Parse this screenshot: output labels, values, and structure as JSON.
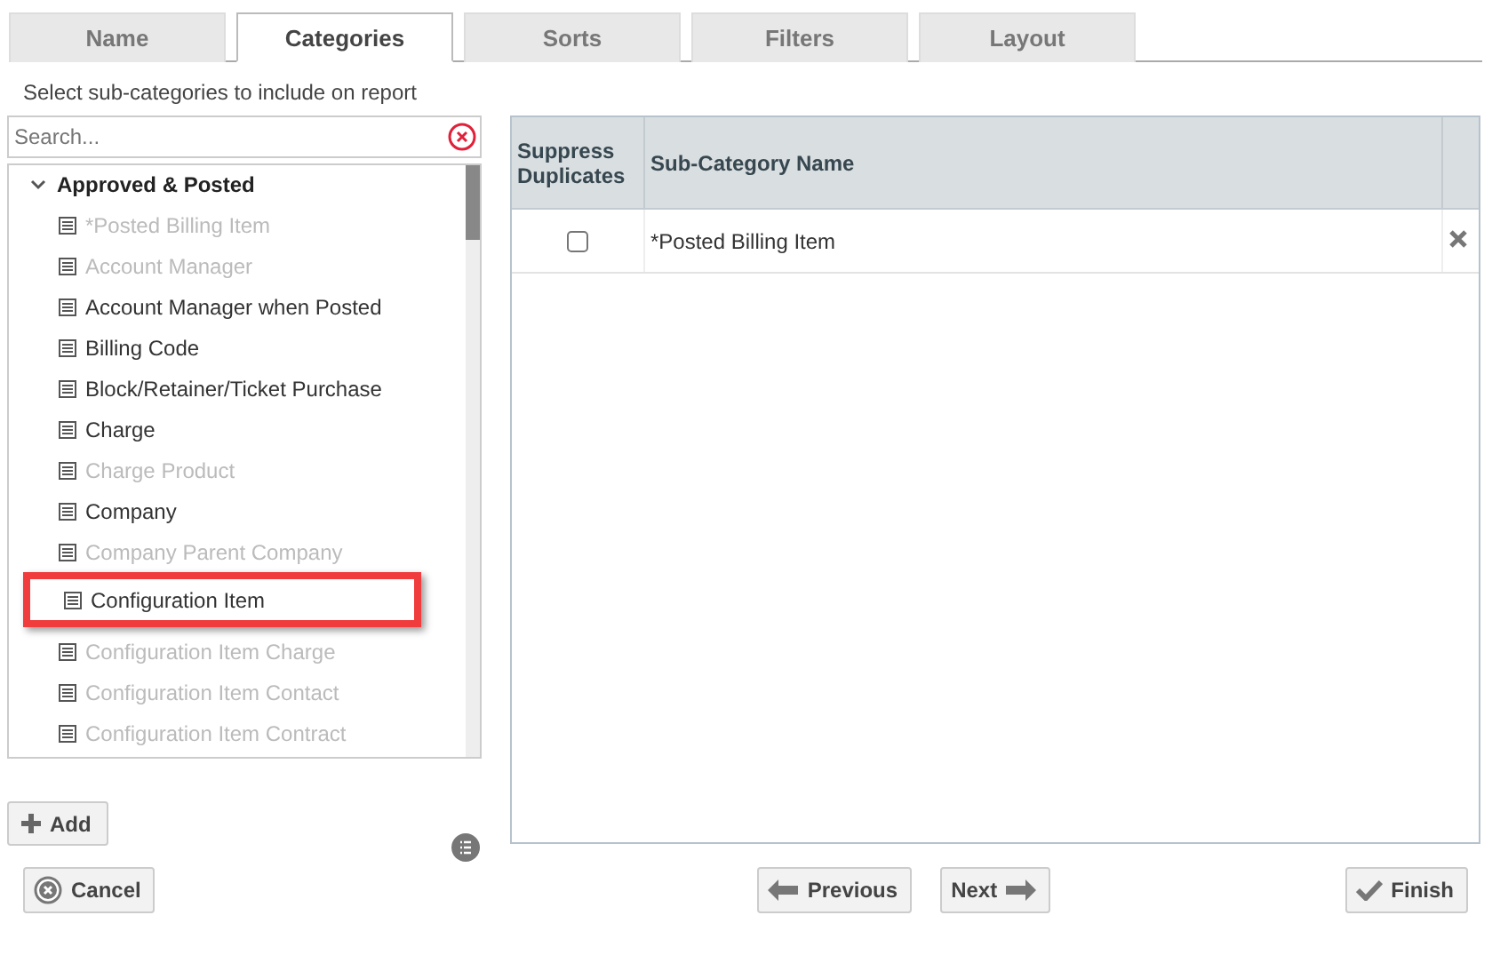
{
  "tabs": [
    {
      "label": "Name",
      "selected": false
    },
    {
      "label": "Categories",
      "selected": true
    },
    {
      "label": "Sorts",
      "selected": false
    },
    {
      "label": "Filters",
      "selected": false
    },
    {
      "label": "Layout",
      "selected": false
    }
  ],
  "instruction": "Select sub-categories to include on report",
  "search": {
    "placeholder": "Search..."
  },
  "tree": {
    "label": "Approved & Posted",
    "expanded": true,
    "children": [
      {
        "label": "*Posted Billing Item",
        "disabled": true,
        "highlighted": false
      },
      {
        "label": "Account Manager",
        "disabled": true,
        "highlighted": false
      },
      {
        "label": "Account Manager when Posted",
        "disabled": false,
        "highlighted": false
      },
      {
        "label": "Billing Code",
        "disabled": false,
        "highlighted": false
      },
      {
        "label": "Block/Retainer/Ticket Purchase",
        "disabled": false,
        "highlighted": false
      },
      {
        "label": "Charge",
        "disabled": false,
        "highlighted": false
      },
      {
        "label": "Charge Product",
        "disabled": true,
        "highlighted": false
      },
      {
        "label": "Company",
        "disabled": false,
        "highlighted": false
      },
      {
        "label": "Company Parent Company",
        "disabled": true,
        "highlighted": false
      },
      {
        "label": "Configuration Item",
        "disabled": false,
        "highlighted": true
      },
      {
        "label": "Configuration Item Charge",
        "disabled": true,
        "highlighted": false
      },
      {
        "label": "Configuration Item Contact",
        "disabled": true,
        "highlighted": false
      },
      {
        "label": "Configuration Item Contract",
        "disabled": true,
        "highlighted": false
      }
    ]
  },
  "add_button": "Add",
  "grid": {
    "columns": [
      "Suppress Duplicates",
      "Sub-Category Name"
    ],
    "rows": [
      {
        "suppress_duplicates": false,
        "name": "*Posted Billing Item"
      }
    ]
  },
  "buttons": [
    {
      "kind": "cancel",
      "label": "Cancel"
    },
    {
      "kind": "previous",
      "label": "Previous"
    },
    {
      "kind": "next",
      "label": "Next"
    },
    {
      "kind": "finish",
      "label": "Finish"
    }
  ]
}
